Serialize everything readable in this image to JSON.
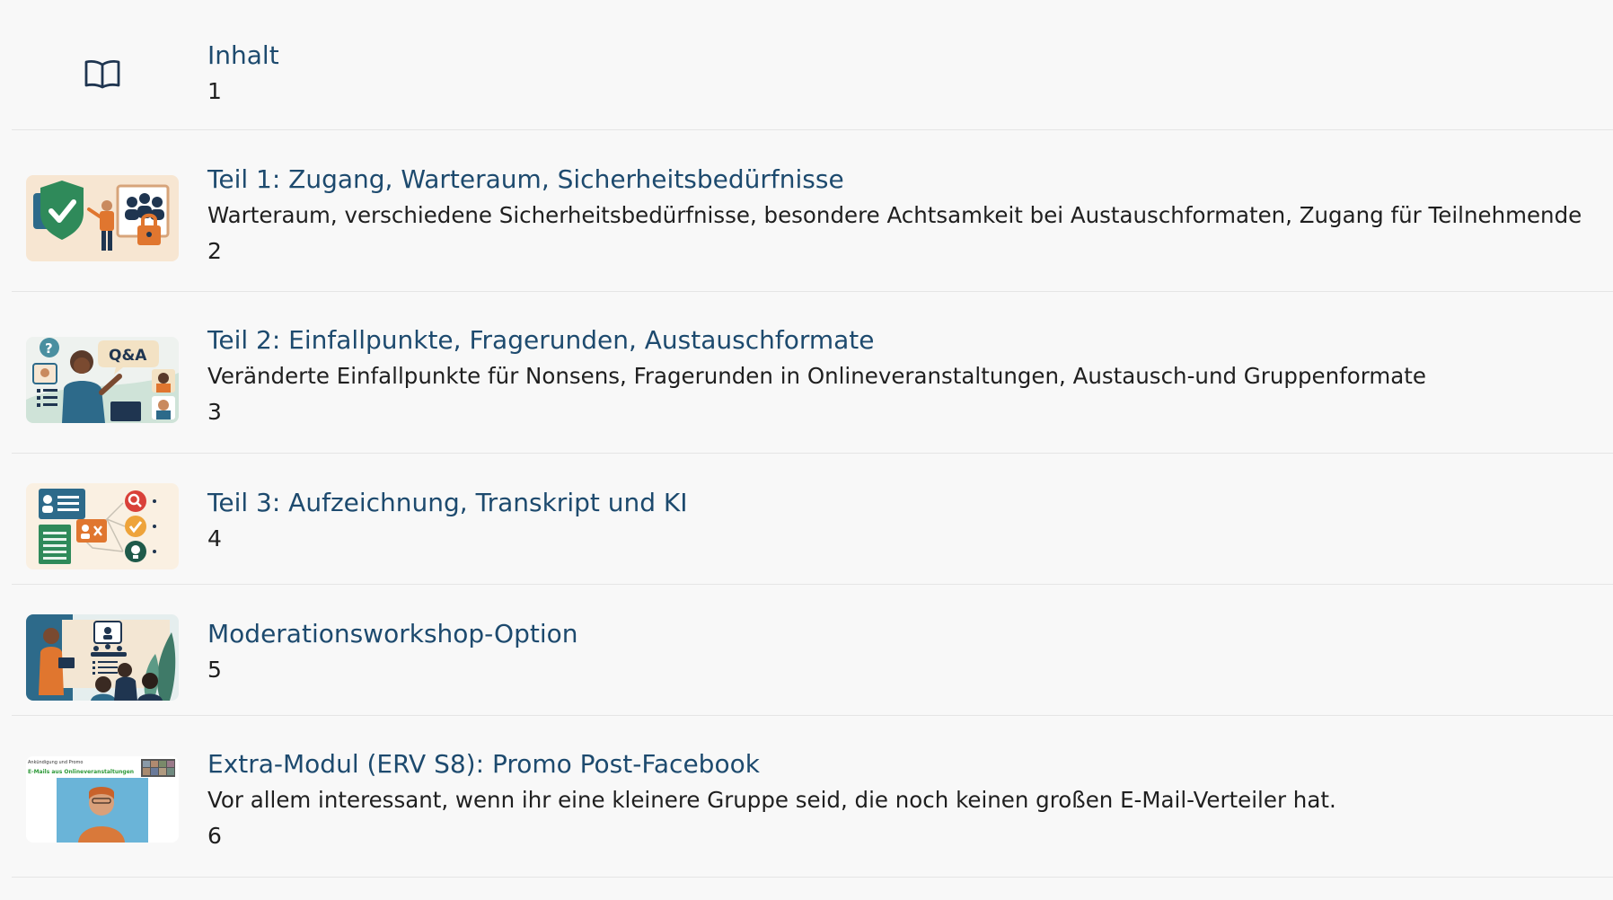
{
  "colors": {
    "title": "#1d4a6e",
    "text": "#1f1f1f",
    "background": "#f8f8f8",
    "divider": "#e5e5e5"
  },
  "items": [
    {
      "icon": "book-open-icon",
      "title": "Inhalt",
      "description": "",
      "number": "1"
    },
    {
      "icon": "security-illustration",
      "title": "Teil 1: Zugang, Warteraum, Sicherheitsbedürfnisse",
      "description": "Warteraum, verschiedene Sicherheitsbedürfnisse, besondere Achtsamkeit bei Austauschformaten, Zugang für Teilnehmende",
      "number": "2"
    },
    {
      "icon": "qa-illustration",
      "title": "Teil 2: Einfallpunkte, Fragerunden, Austauschformate",
      "description": "Veränderte Einfallpunkte für Nonsens, Fragerunden in Onlineveranstaltungen, Austausch-und Gruppenformate",
      "number": "3"
    },
    {
      "icon": "transcript-ai-illustration",
      "title": "Teil 3: Aufzeichnung, Transkript und KI",
      "description": "",
      "number": "4"
    },
    {
      "icon": "workshop-illustration",
      "title": "Moderationsworkshop-Option",
      "description": "",
      "number": "5"
    },
    {
      "icon": "video-slide-thumbnail",
      "title": "Extra-Modul (ERV S8): Promo Post-Facebook",
      "description": "Vor allem interessant, wenn ihr eine kleinere Gruppe seid, die noch keinen großen E-Mail-Verteiler hat.",
      "number": "6",
      "thumbnail_text": {
        "caption_small": "Ankündigung und Promo",
        "caption_green": "E-Mails aus Onlineveranstaltungen"
      }
    }
  ]
}
